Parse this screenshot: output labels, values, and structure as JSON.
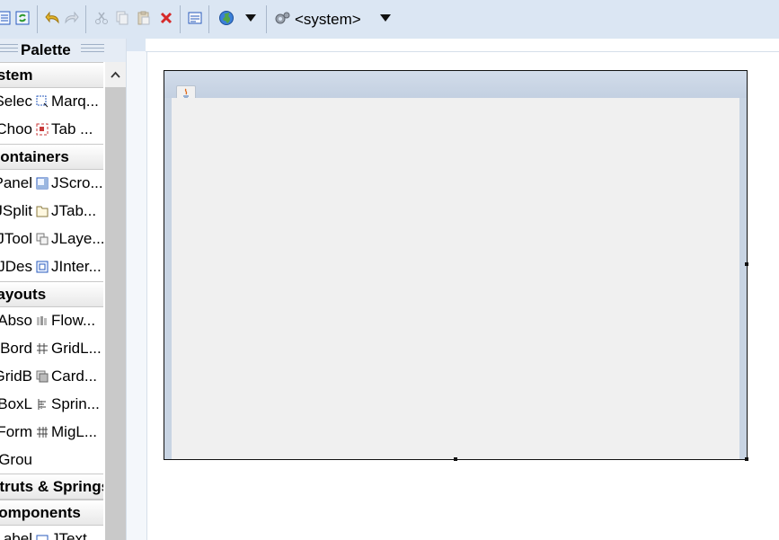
{
  "toolbar": {
    "icons": [
      "outline-icon",
      "refresh-icon",
      "undo-icon",
      "redo-icon",
      "cut-icon",
      "copy-icon",
      "paste-icon",
      "delete-icon",
      "properties-icon",
      "globe-icon",
      "system-laf-icon"
    ],
    "laf_value": "<system>"
  },
  "palette": {
    "title": "Palette",
    "categories": [
      {
        "label": "System"
      },
      {
        "label": "Containers"
      },
      {
        "label": "Layouts"
      },
      {
        "label": "Struts & Springs"
      },
      {
        "label": "Components"
      }
    ],
    "rows": [
      {
        "left": "Selec...",
        "right": "Marq..."
      },
      {
        "left": "Choo...",
        "right": "Tab ..."
      },
      {
        "left": "JPanel",
        "right": "JScro..."
      },
      {
        "left": "JSplit...",
        "right": "JTab..."
      },
      {
        "left": "JTool...",
        "right": "JLaye..."
      },
      {
        "left": "JDes...",
        "right": "JInter..."
      },
      {
        "left": "Abso...",
        "right": "Flow..."
      },
      {
        "left": "Bord...",
        "right": "GridL..."
      },
      {
        "left": "GridB...",
        "right": "Card..."
      },
      {
        "left": "BoxL...",
        "right": "Sprin..."
      },
      {
        "left": "Form...",
        "right": "MigL..."
      },
      {
        "left": "Grou...",
        "right": ""
      },
      {
        "left": "JLabel",
        "right": "JText..."
      }
    ]
  },
  "colors": {
    "toolbar_bg": "#dbe6f3",
    "frame_title": "#c8d4e3",
    "content_bg": "#f0f0f0"
  }
}
